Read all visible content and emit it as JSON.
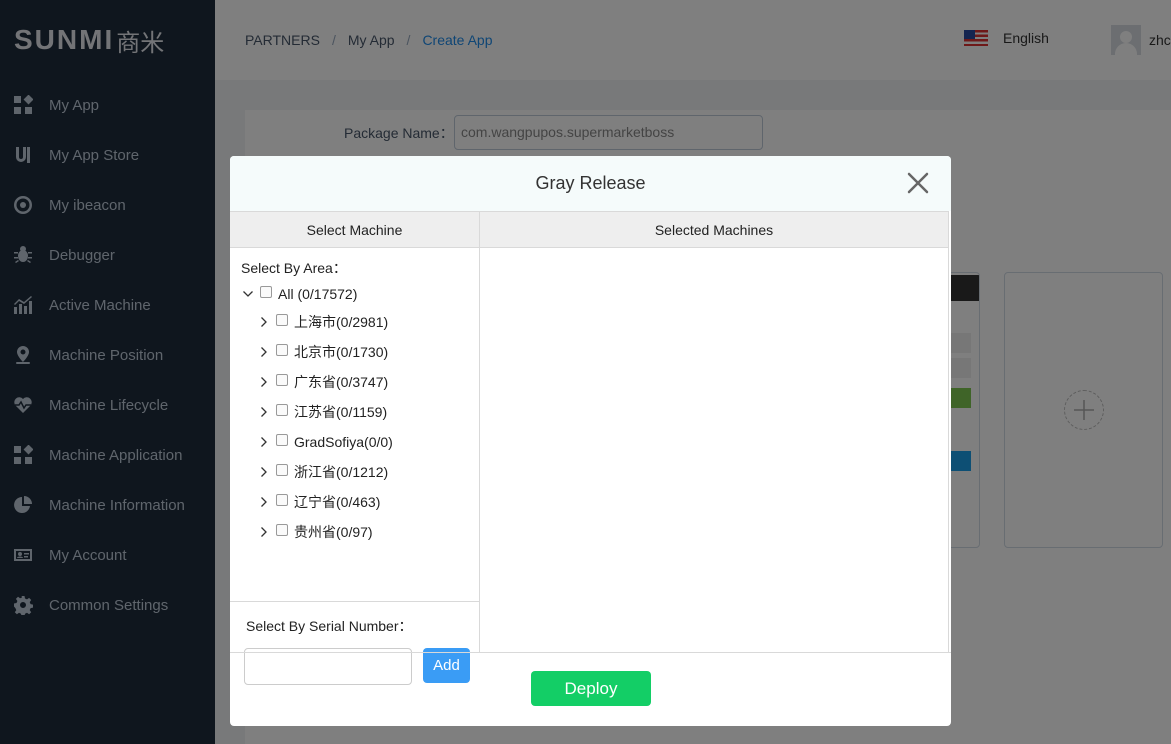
{
  "brand": {
    "logo_text": "SUNMI",
    "logo_cn": "商米"
  },
  "sidebar": {
    "items": [
      {
        "label": "My App",
        "icon": "grid-icon"
      },
      {
        "label": "My App Store",
        "icon": "store-icon"
      },
      {
        "label": "My ibeacon",
        "icon": "beacon-icon"
      },
      {
        "label": "Debugger",
        "icon": "bug-icon"
      },
      {
        "label": "Active Machine",
        "icon": "bar-chart-icon"
      },
      {
        "label": "Machine Position",
        "icon": "location-pin-icon"
      },
      {
        "label": "Machine Lifecycle",
        "icon": "heartbeat-icon"
      },
      {
        "label": "Machine Application",
        "icon": "grid-icon"
      },
      {
        "label": "Machine Information",
        "icon": "pie-chart-icon"
      },
      {
        "label": "My Account",
        "icon": "id-card-icon"
      },
      {
        "label": "Common Settings",
        "icon": "gear-icon"
      }
    ]
  },
  "header": {
    "breadcrumb": [
      "PARTNERS",
      "My App",
      "Create App"
    ],
    "separator": "/",
    "language": "English",
    "username": "zhc"
  },
  "form": {
    "package_name_label": "Package Name：",
    "package_name_value": "com.wangpupos.supermarketboss"
  },
  "modal": {
    "title": "Gray Release",
    "left_header": "Select Machine",
    "right_header": "Selected Machines",
    "area_label": "Select By Area：",
    "tree_root": "All (0/17572)",
    "tree_children": [
      "上海市(0/2981)",
      "北京市(0/1730)",
      "广东省(0/3747)",
      "江苏省(0/1159)",
      "GradSofiya(0/0)",
      "浙江省(0/1212)",
      "辽宁省(0/463)",
      "贵州省(0/97)"
    ],
    "serial_label": "Select By Serial Number：",
    "serial_value": "",
    "add_label": "Add",
    "deploy_label": "Deploy"
  },
  "colors": {
    "sidebar_bg": "#1f2d3d",
    "accent_blue": "#3a9cf5",
    "deploy_green": "#13ce66"
  }
}
